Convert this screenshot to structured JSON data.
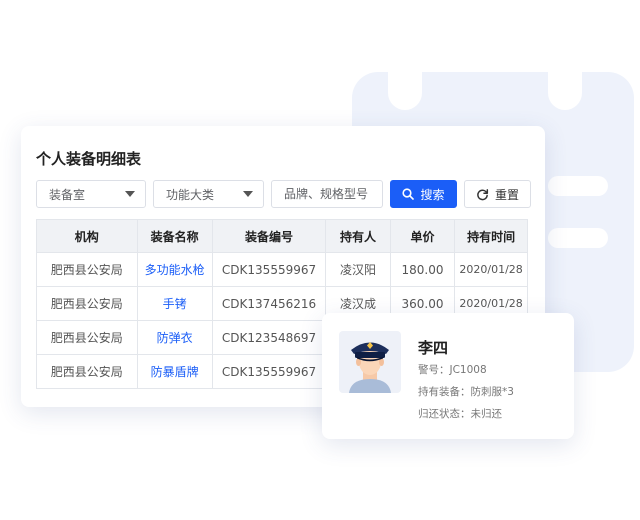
{
  "page": {
    "title": "个人装备明细表"
  },
  "filters": {
    "dept_select": "装备室",
    "type_select": "功能大类",
    "model_placeholder": "品牌、规格型号",
    "search_label": "搜索",
    "reset_label": "重置"
  },
  "table": {
    "headers": [
      "机构",
      "装备名称",
      "装备编号",
      "持有人",
      "单价",
      "持有时间"
    ],
    "rows": [
      [
        "肥西县公安局",
        "多功能水枪",
        "CDK135559967",
        "凌汉阳",
        "180.00",
        "2020/01/28"
      ],
      [
        "肥西县公安局",
        "手铐",
        "CDK137456216",
        "凌汉成",
        "360.00",
        "2020/01/28"
      ],
      [
        "肥西县公安局",
        "防弹衣",
        "CDK123548697",
        "",
        "",
        ""
      ],
      [
        "肥西县公安局",
        "防暴盾牌",
        "CDK135559967",
        "",
        "",
        ""
      ]
    ]
  },
  "profile": {
    "name": "李四",
    "badge": "警号：JC1008",
    "equipment": "持有装备：防刺服*3",
    "status": "归还状态：未归还"
  },
  "colors": {
    "primary": "#1b5ef7",
    "header_bg": "#f0f2f5",
    "background_deco": "#eef2fb"
  }
}
